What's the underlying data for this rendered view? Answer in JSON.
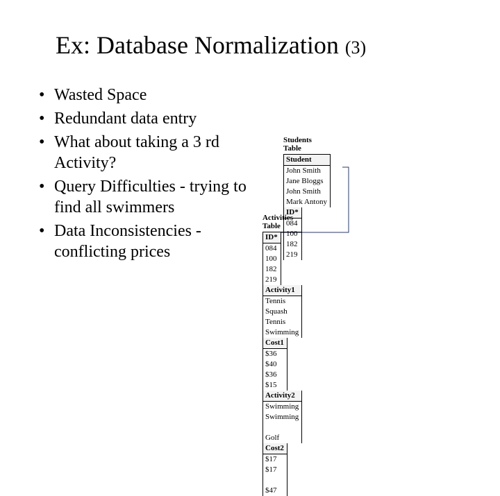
{
  "title_main": "Ex: Database Normalization ",
  "title_sub": "(3)",
  "bullets": [
    "Wasted Space",
    "Redundant data entry",
    "What about taking a 3 rd Activity?",
    "Query Difficulties - trying to find all swimmers",
    "Data Inconsistencies - conflicting prices"
  ],
  "students_table": {
    "label": "Students Table",
    "headers": [
      "Student",
      "ID*"
    ],
    "rows": [
      [
        "John Smith",
        "084"
      ],
      [
        "Jane Bloggs",
        "100"
      ],
      [
        "John Smith",
        "182"
      ],
      [
        "Mark Antony",
        "219"
      ]
    ]
  },
  "activities_table": {
    "label": "Activities Table",
    "headers": [
      "ID*",
      "Activity1",
      "Cost1",
      "Activity2",
      "Cost2"
    ],
    "rows": [
      [
        "084",
        "Tennis",
        "$36",
        "Swimming",
        "$17"
      ],
      [
        "100",
        "Squash",
        "$40",
        "Swimming",
        "$17"
      ],
      [
        "182",
        "Tennis",
        "$36",
        "",
        ""
      ],
      [
        "219",
        "Swimming",
        "$15",
        "Golf",
        "$47"
      ]
    ]
  }
}
